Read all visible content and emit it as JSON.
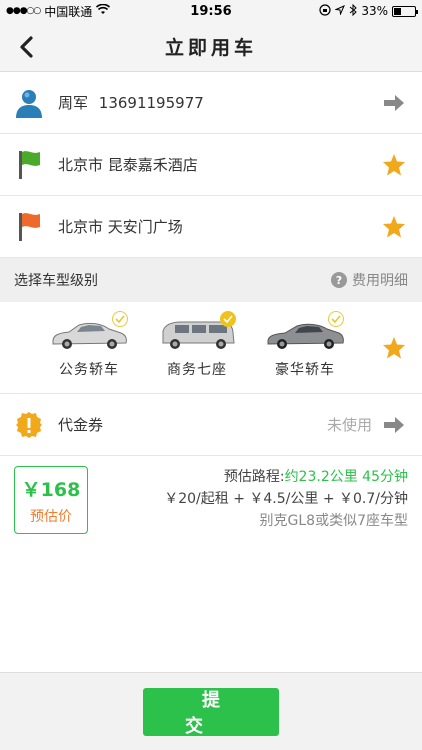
{
  "status_bar": {
    "carrier": "中国联通",
    "time": "19:56",
    "battery": "33%",
    "battery_level": 0.33
  },
  "nav": {
    "title": "立即用车",
    "back_icon": "back-arrow-icon"
  },
  "passenger": {
    "name": "周军",
    "phone": "13691195977",
    "icon": "person-icon",
    "action_icon": "arrow-right-icon"
  },
  "start_location": {
    "text": "北京市 昆泰嘉禾酒店",
    "icon": "green-flag-icon",
    "action_icon": "star-icon"
  },
  "end_location": {
    "text": "北京市 天安门广场",
    "icon": "orange-flag-icon",
    "action_icon": "star-icon"
  },
  "car_section": {
    "title": "选择车型级别",
    "fee_detail": "费用明细",
    "cars": [
      {
        "label": "公务轿车",
        "selected": false
      },
      {
        "label": "商务七座",
        "selected": true
      },
      {
        "label": "豪华轿车",
        "selected": false
      }
    ]
  },
  "coupon": {
    "label": "代金券",
    "status": "未使用",
    "icon": "exclamation-icon"
  },
  "estimate": {
    "price": "￥168",
    "price_label": "预估价",
    "route_label": "预估路程:",
    "route_value": "约23.2公里 45分钟",
    "fare": "￥20/起租 + ￥4.5/公里 + ￥0.7/分钟",
    "car_model": "别克GL8或类似7座车型"
  },
  "submit": {
    "label": "提交"
  },
  "colors": {
    "accent_green": "#2cc14a",
    "price_orange": "#ef7d2d",
    "star_gold": "#f1a81b"
  }
}
